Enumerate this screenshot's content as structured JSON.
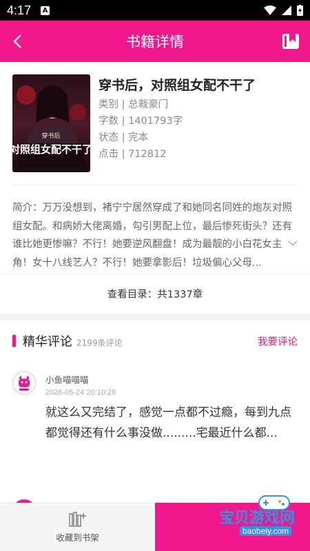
{
  "status_bar": {
    "time": "4:17"
  },
  "app_bar": {
    "title": "书籍详情"
  },
  "book": {
    "title": "穿书后，对照组女配不干了",
    "category": "类别 | 总裁豪门",
    "word_count": "字数 | 1401793字",
    "status": "状态 | 完本",
    "clicks": "点击 | 712812",
    "cover_title": "对照组女配不干了",
    "cover_tag": "穿书后"
  },
  "intro": {
    "text": "简介：万万没想到，褚宁宁居然穿成了和她同名同姓的炮灰对照组女配。和病娇大佬离婚，勾引男配上位，最后惨死街头？还有谁比她更惨嘛？不行！她要逆风翻盘！成为最靓的小白花女主角！女十八线艺人？不行！她要拿影后！垃圾偏心父母..."
  },
  "catalog": {
    "label": "查看目录：共1337章"
  },
  "comments": {
    "heading": "精华评论",
    "count": "2199条评论",
    "write_label": "我要评论",
    "items": [
      {
        "user": "小鱼喵喵喵",
        "time": "2026-05-24 20:10:28",
        "text": "就这么又完结了，感觉一点都不过瘾，每到九点都觉得还有什么事没做.........宅最近什么都..."
      }
    ]
  },
  "bottom_bar": {
    "collect_label": "收藏到书架"
  },
  "watermark": {
    "text": "宝贝游戏网",
    "url": "baobeiy.com"
  },
  "colors": {
    "accent": "#f0188c",
    "status_bar": "#000000"
  }
}
